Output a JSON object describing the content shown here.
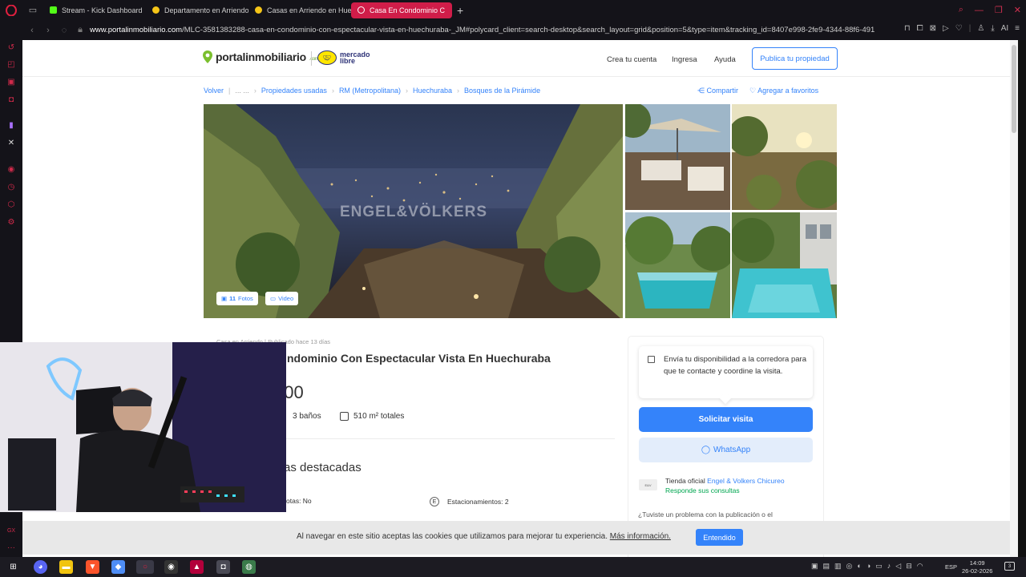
{
  "browser": {
    "tabs": [
      {
        "label": "Stream - Kick Dashboard",
        "color": "#53fc18"
      },
      {
        "label": "Departamento en Arriendo",
        "color": "#f5c518"
      },
      {
        "label": "Casas en Arriendo en Hue",
        "color": "#f5c518"
      },
      {
        "label": "Casa En Condominio C",
        "color": "#ffffff"
      }
    ],
    "url_domain": "www.portalinmobiliario.com",
    "url_path": "/MLC-3581383288-casa-en-condominio-con-espectacular-vista-en-huechuraba-_JM#polycard_client=search-desktop&search_layout=grid&position=5&type=item&tracking_id=8407e998-2fe9-4344-88f6-491",
    "ai_label": "AI",
    "gx_label": "GX"
  },
  "header": {
    "logo_text": "portalinmobiliario",
    "logo_tld": ".com",
    "ml_logo_text": "mercado libre",
    "nav": [
      "Crea tu cuenta",
      "Ingresa",
      "Ayuda"
    ],
    "publish_label": "Publica tu propiedad"
  },
  "breadcrumb": {
    "back": "Volver",
    "items": [
      "... ...",
      "Propiedades usadas",
      "RM (Metropolitana)",
      "Huechuraba",
      "Bosques de la Pirámide"
    ],
    "share": "Compartir",
    "favorite": "Agregar a favoritos"
  },
  "gallery": {
    "watermark": "ENGEL&VÖLKERS",
    "photos_count": "11",
    "photos_label": "Fotos",
    "video_label": "Video"
  },
  "listing": {
    "meta": "Casa en Arriendo  |  Publicado hace 13 días",
    "title_visible": "ndominio Con Espectacular Vista En Huechuraba",
    "price_visible": "000",
    "baths": "3 baños",
    "area": "510 m² totales",
    "section_title_visible": "as destacadas",
    "pets_visible": "otas: No",
    "parking": "Estacionamientos: 2"
  },
  "contact": {
    "note": "Envía tu disponibilidad a la corredora para que te contacte y coordine la visita.",
    "request_visit": "Solicitar visita",
    "whatsapp": "WhatsApp",
    "store_prefix": "Tienda oficial",
    "store_name": "Engel & Volkers Chicureo",
    "store_response": "Responde sus consultas",
    "problem_text": "¿Tuviste un problema con la publicación o el"
  },
  "cookie": {
    "message": "Al navegar en este sitio aceptas las cookies que utilizamos para mejorar tu experiencia.",
    "more": "Más información.",
    "accept": "Entendido"
  },
  "taskbar": {
    "lang": "ESP",
    "time": "14:09",
    "date": "26-02-2026",
    "notif_count": "3"
  },
  "colors": {
    "accent": "#3483fa",
    "opera_red": "#d01d49",
    "ml_yellow": "#ffe600"
  }
}
